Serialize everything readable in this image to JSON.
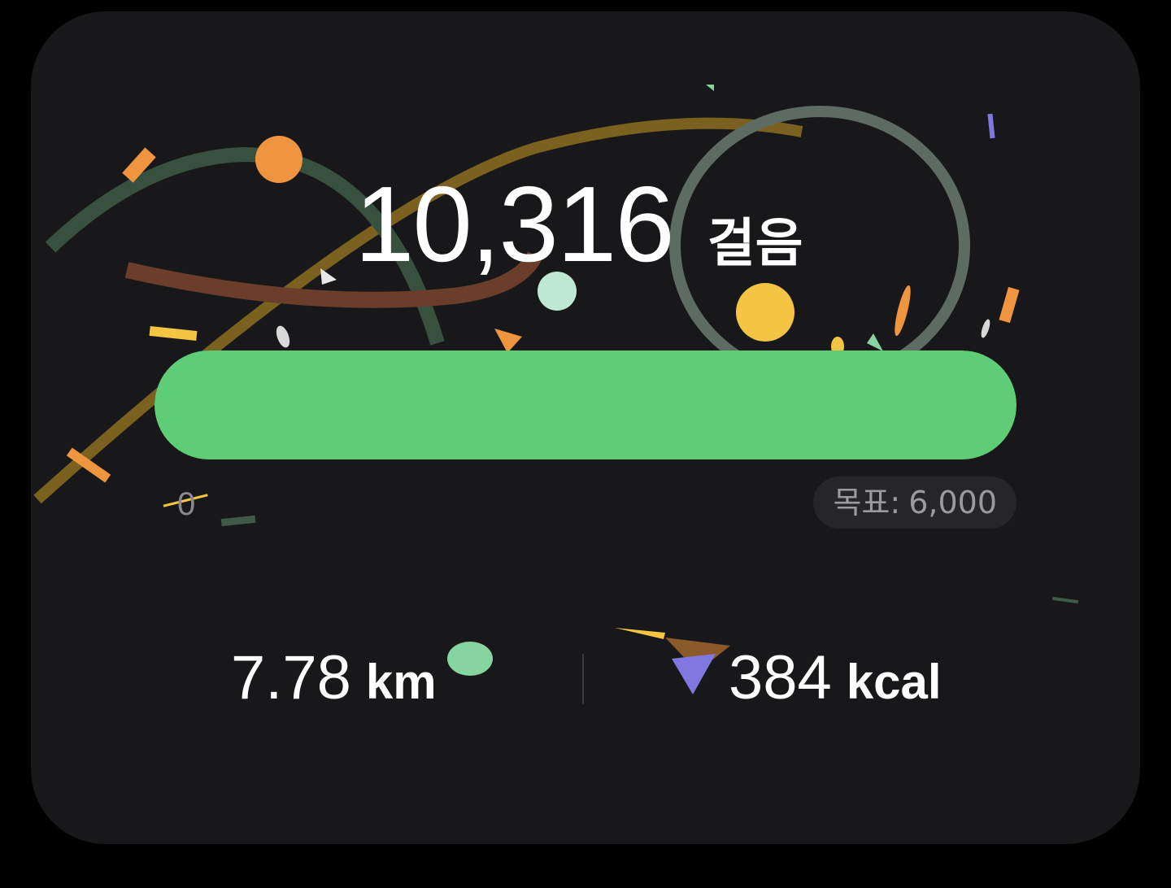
{
  "steps": {
    "value": "10,316",
    "unit": "걸음"
  },
  "progress": {
    "fraction": 1.0,
    "fill_color": "#5fcd78",
    "min_label": "0",
    "goal_label": "목표:",
    "goal_value": "6,000"
  },
  "stats": {
    "distance_value": "7.78",
    "distance_unit": "km",
    "calories_value": "384",
    "calories_unit": "kcal"
  },
  "theme": {
    "card_bg": "#18181a",
    "confetti_colors": [
      "#f0953f",
      "#f4c542",
      "#7f78e0",
      "#86d4a0",
      "#bfe8d2",
      "#3f5a48"
    ]
  }
}
